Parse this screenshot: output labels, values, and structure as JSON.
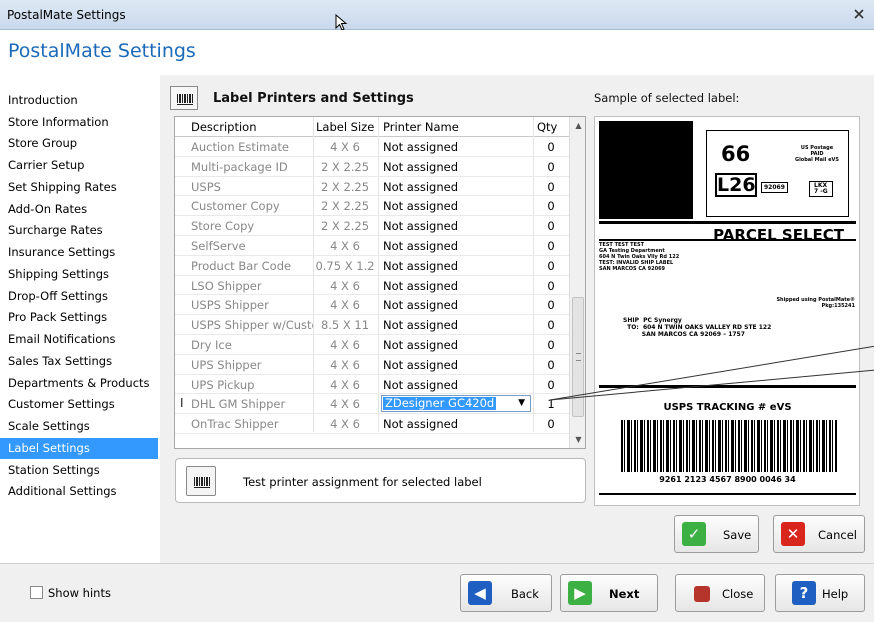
{
  "window": {
    "title": "PostalMate Settings"
  },
  "header": {
    "title": "PostalMate Settings"
  },
  "nav": {
    "items": [
      {
        "label": "Introduction"
      },
      {
        "label": "Store Information"
      },
      {
        "label": "Store Group"
      },
      {
        "label": "Carrier Setup"
      },
      {
        "label": "Set Shipping Rates"
      },
      {
        "label": "Add-On Rates"
      },
      {
        "label": "Surcharge Rates"
      },
      {
        "label": "Insurance Settings"
      },
      {
        "label": "Shipping Settings"
      },
      {
        "label": "Drop-Off Settings"
      },
      {
        "label": "Pro Pack Settings"
      },
      {
        "label": "Email Notifications"
      },
      {
        "label": "Sales Tax Settings"
      },
      {
        "label": "Departments & Products"
      },
      {
        "label": "Customer Settings"
      },
      {
        "label": "Scale Settings"
      },
      {
        "label": "Label Settings"
      },
      {
        "label": "Station Settings"
      },
      {
        "label": "Additional Settings"
      }
    ],
    "selected": "Label Settings"
  },
  "section": {
    "title": "Label Printers and Settings",
    "sample_title": "Sample of selected label:"
  },
  "grid": {
    "columns": {
      "description": "Description",
      "label_size": "Label Size",
      "printer": "Printer Name",
      "qty": "Qty"
    },
    "rows": [
      {
        "description": "Auction Estimate",
        "size": "4 X 6",
        "printer": "Not assigned",
        "qty": "0"
      },
      {
        "description": "Multi-package ID",
        "size": "2 X 2.25",
        "printer": "Not assigned",
        "qty": "0"
      },
      {
        "description": "USPS",
        "size": "2 X 2.25",
        "printer": "Not assigned",
        "qty": "0"
      },
      {
        "description": "Customer Copy",
        "size": "2 X 2.25",
        "printer": "Not assigned",
        "qty": "0"
      },
      {
        "description": "Store Copy",
        "size": "2 X 2.25",
        "printer": "Not assigned",
        "qty": "0"
      },
      {
        "description": "SelfServe",
        "size": "4 X 6",
        "printer": "Not assigned",
        "qty": "0"
      },
      {
        "description": "Product Bar Code",
        "size": "0.75 X 1.2",
        "printer": "Not assigned",
        "qty": "0"
      },
      {
        "description": "LSO Shipper",
        "size": "4 X 6",
        "printer": "Not assigned",
        "qty": "0"
      },
      {
        "description": "USPS Shipper",
        "size": "4 X 6",
        "printer": "Not assigned",
        "qty": "0"
      },
      {
        "description": "USPS Shipper w/Custor",
        "size": "8.5 X 11",
        "printer": "Not assigned",
        "qty": "0"
      },
      {
        "description": "Dry Ice",
        "size": "4 X 6",
        "printer": "Not assigned",
        "qty": "0"
      },
      {
        "description": "UPS Shipper",
        "size": "4 X 6",
        "printer": "Not assigned",
        "qty": "0"
      },
      {
        "description": "UPS Pickup",
        "size": "4 X 6",
        "printer": "Not assigned",
        "qty": "0"
      },
      {
        "description": "DHL GM Shipper",
        "size": "4 X 6",
        "printer": "ZDesigner GC420d",
        "qty": "1"
      },
      {
        "description": "OnTrac Shipper",
        "size": "4 X 6",
        "printer": "Not assigned",
        "qty": "0"
      }
    ]
  },
  "test": {
    "label": "Test printer assignment for selected label"
  },
  "sample_label": {
    "zone": "66",
    "route": "L26",
    "postage_lines": "US Postage\nPAID\nGlobal Mail eVS",
    "zip": "92069",
    "lkx": "LKX\n7 -G",
    "service": "PARCEL SELECT",
    "return_address": "TEST TEST TEST\nGA Testing Department\n604 N Twin Oaks Vlly Rd 122\nTEST: INVALID SHIP LABEL\nSAN MARCOS CA 92069",
    "shipped_using": "Shipped using PostalMate®\nPkg:135241",
    "ship_to": "SHIP  PC Synergy\n  TO:  604 N TWIN OAKS VALLEY RD STE 122\n         SAN MARCOS CA 92069 – 1757",
    "tracking_title": "USPS TRACKING # eVS",
    "tracking_number": "9261 2123 4567 8900 0046 34"
  },
  "buttons": {
    "save": "Save",
    "cancel": "Cancel",
    "back": "Back",
    "next": "Next",
    "close": "Close",
    "help": "Help"
  },
  "footer": {
    "show_hints": "Show hints"
  },
  "colors": {
    "accent": "#1b6ab9",
    "selected": "#3399ff",
    "save_green": "#3cb043",
    "cancel_red": "#d9261c",
    "help_blue": "#1e5fc1",
    "close_red": "#b5352c"
  }
}
